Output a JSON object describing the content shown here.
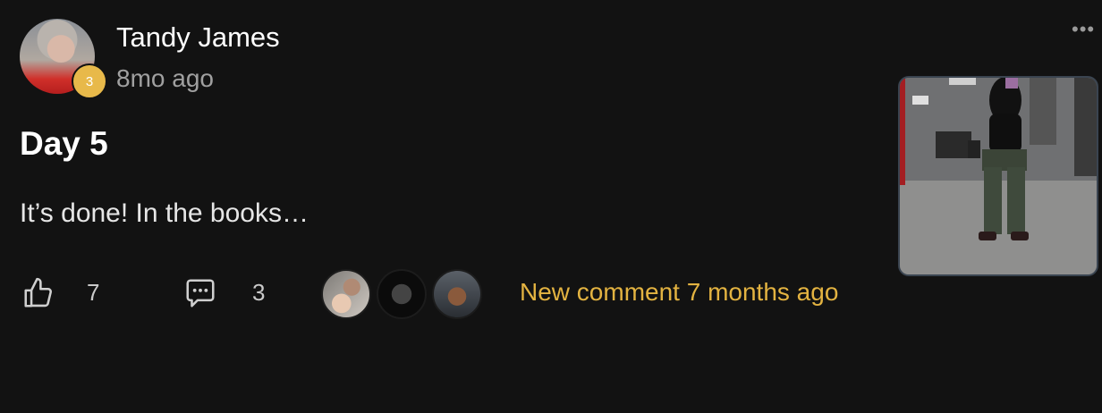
{
  "post": {
    "author": "Tandy James",
    "level": "3",
    "timestamp": "8mo ago",
    "title": "Day 5",
    "body": "It’s done! In the books…",
    "more_icon": "ellipsis-icon"
  },
  "actions": {
    "like_count": "7",
    "comment_count": "3",
    "like_icon": "thumbs-up-icon",
    "comment_icon": "comment-bubble-icon"
  },
  "activity": {
    "new_comment_text": "New comment 7 months ago",
    "accent_color": "#e3b341"
  },
  "theme": {
    "background": "#121212",
    "text": "#ffffff",
    "muted": "#a0a0a0",
    "badge": "#e8b94a"
  }
}
